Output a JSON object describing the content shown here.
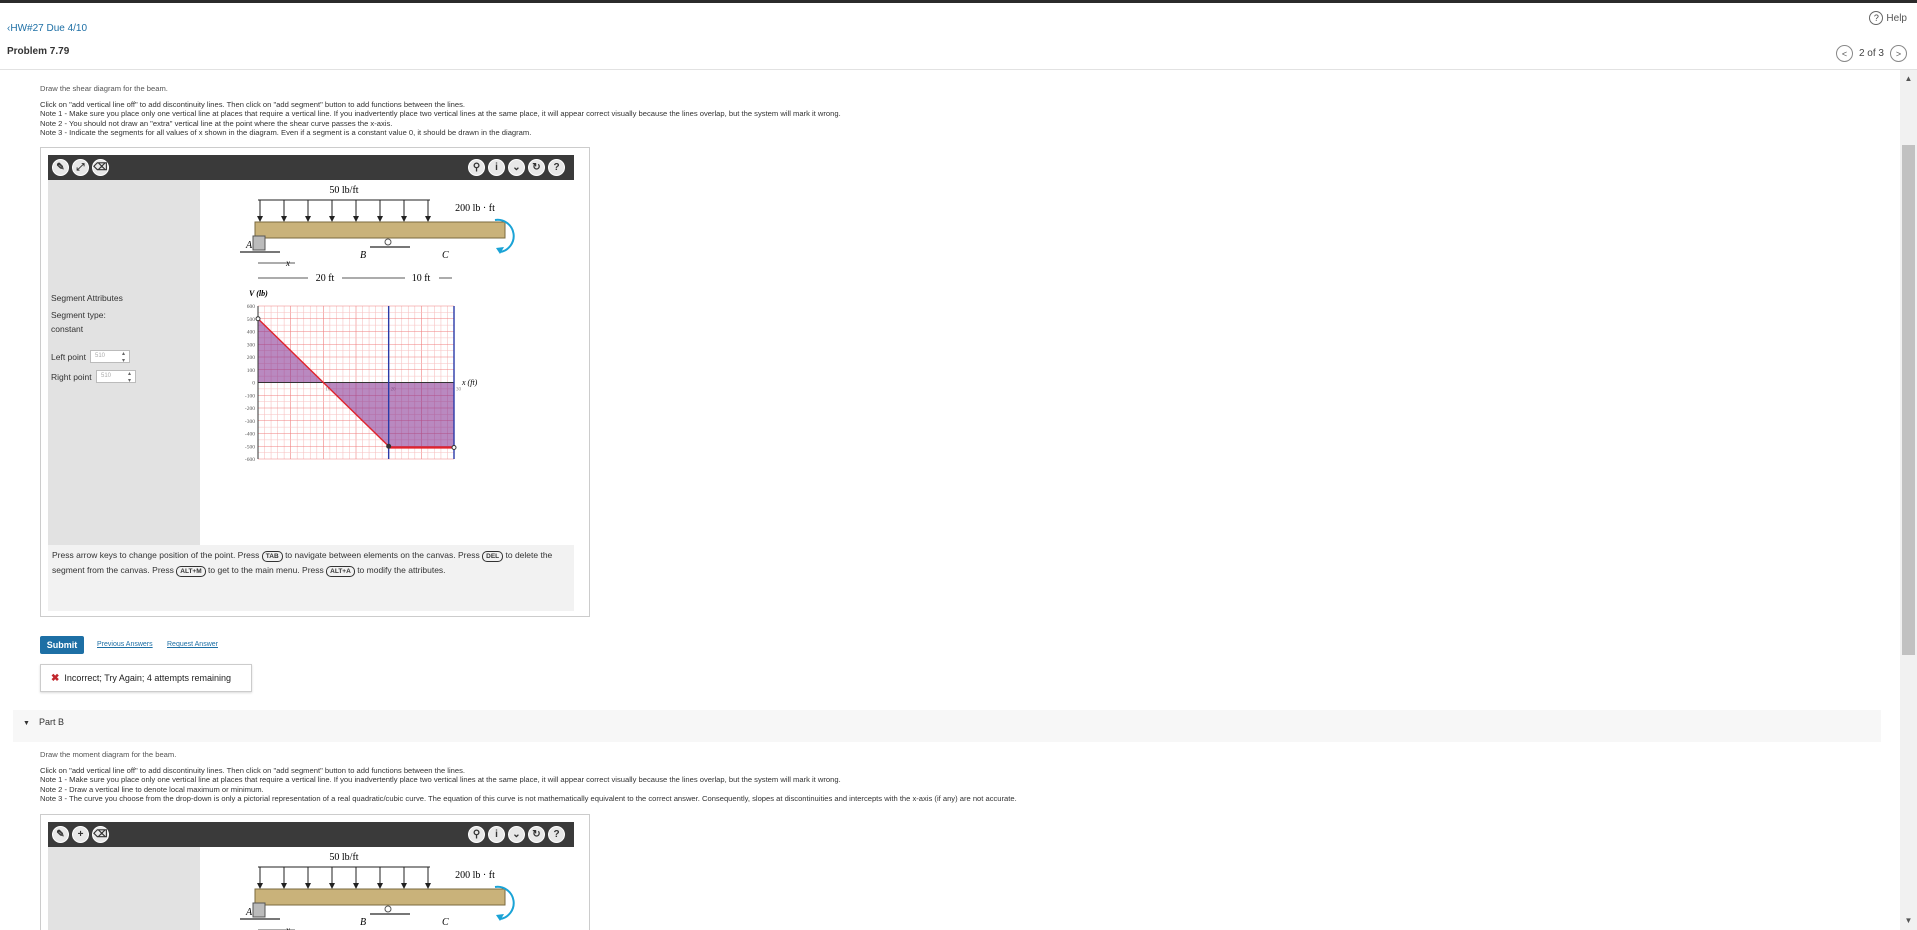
{
  "header": {
    "back_link": "HW#27 Due 4/10",
    "problem_title": "Problem 7.79",
    "help_label": "Help",
    "pager_label": "2 of 3"
  },
  "partA": {
    "lead": "Draw the shear diagram for the beam.",
    "lines": [
      "Click on \"add vertical line off\" to add discontinuity lines. Then click on \"add segment\" button to add functions between the lines.",
      "Note 1 - Make sure you place only one vertical line at places that require a vertical line. If you inadvertently place two vertical lines at the same place, it will appear correct visually because the lines overlap, but the system will mark it wrong.",
      "Note 2 - You should not draw an \"extra\" vertical line at the point where the shear curve passes the x-axis.",
      "Note 3 - Indicate the segments for all values of x shown in the diagram. Even if a segment is a constant value 0, it should be drawn in the diagram."
    ],
    "segment": {
      "heading": "Segment Attributes",
      "type_label": "Segment type:",
      "type_value": "constant",
      "left_label": "Left point",
      "left_value": "510",
      "right_label": "Right point",
      "right_value": "510"
    },
    "footnote": {
      "t1": "Press arrow keys to change position of the point. Press",
      "k1": "TAB",
      "t2": "to navigate between elements on the canvas. Press",
      "k2": "DEL",
      "t3": "to delete the segment from the canvas. Press",
      "k3": "ALT+M",
      "t4": "to get to the main menu. Press",
      "k4": "ALT+A",
      "t5": "to modify the attributes."
    },
    "submit_label": "Submit",
    "prev_answers": "Previous Answers",
    "request_answer": "Request Answer",
    "feedback": "Incorrect; Try Again; 4 attempts remaining"
  },
  "figure": {
    "load": "50 lb/ft",
    "moment": "200 lb · ft",
    "label_A": "A",
    "label_B": "B",
    "label_C": "C",
    "label_x": "x",
    "dim1": "20 ft",
    "dim2": "10 ft",
    "v_label": "V (lb)",
    "x_label": "x (ft)"
  },
  "chart_data": {
    "type": "line",
    "ylabel": "V (lb)",
    "xlabel": "x (ft)",
    "xlim": [
      0,
      30
    ],
    "ylim": [
      -600,
      600
    ],
    "y_ticks": [
      600,
      500,
      400,
      300,
      200,
      100,
      0,
      -100,
      -200,
      -300,
      -400,
      -500,
      -600
    ],
    "x_ticks": [
      0,
      10,
      20,
      30
    ],
    "vertical_lines_x": [
      20,
      30
    ],
    "series": [
      {
        "x": [
          0,
          20
        ],
        "y": [
          500,
          -500
        ]
      },
      {
        "x": [
          20,
          30
        ],
        "y": [
          -510,
          -510
        ]
      }
    ]
  },
  "partB": {
    "title": "Part B",
    "lead": "Draw the moment diagram for the beam.",
    "lines": [
      "Click on \"add vertical line off\" to add discontinuity lines. Then click on \"add segment\" button to add functions between the lines.",
      "Note 1 - Make sure you place only one vertical line at places that require a vertical line. If you inadvertently place two vertical lines at the same place, it will appear correct visually because the lines overlap, but the system will mark it wrong.",
      "Note 2 - Draw a vertical line to denote local maximum or minimum.",
      "Note 3 - The curve you choose from the drop-down is only a pictorial representation of a real quadratic/cubic curve. The equation of this curve is not mathematically equivalent to the correct answer. Consequently, slopes at discontinuities and intercepts with the x-axis (if any) are not accurate."
    ]
  },
  "tools": {
    "pencil": "✎",
    "add": "+",
    "trash": "🗑",
    "hint": "💡",
    "info": "i",
    "more": "⌄",
    "reset": "↻",
    "help": "?"
  }
}
